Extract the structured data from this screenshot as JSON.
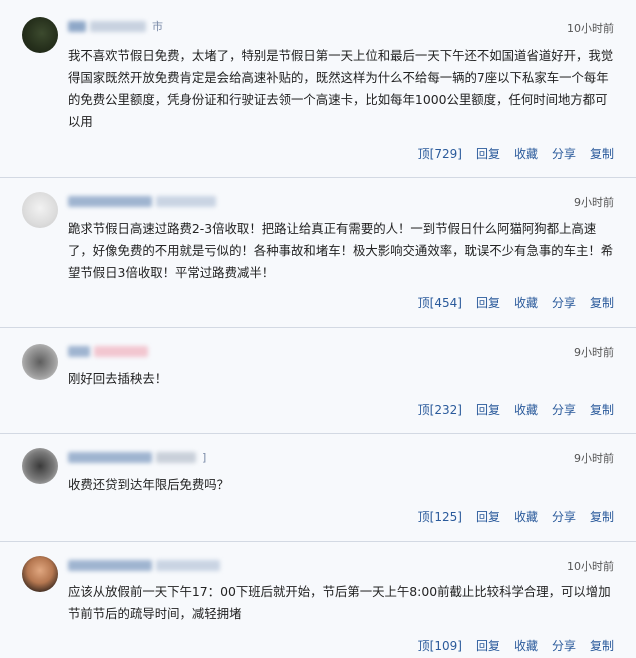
{
  "comments": [
    {
      "location_suffix": "市",
      "time": "10小时前",
      "text": "我不喜欢节假日免费，太堵了，特别是节假日第一天上位和最后一天下午还不如国道省道好开，我觉得国家既然开放免费肯定是会给高速补贴的，既然这样为什么不给每一辆的7座以下私家车一个每年的免费公里额度，凭身份证和行驶证去领一个高速卡，比如每年1000公里额度，任何时间地方都可以用",
      "actions": {
        "up_label": "顶",
        "up_count": "[729]",
        "reply": "回复",
        "favorite": "收藏",
        "share": "分享",
        "copy": "复制"
      }
    },
    {
      "location_suffix": "",
      "time": "9小时前",
      "text": "跪求节假日高速过路费2-3倍收取！把路让给真正有需要的人！一到节假日什么阿猫阿狗都上高速了，好像免费的不用就是亏似的！各种事故和堵车！极大影响交通效率，耽误不少有急事的车主！希望节假日3倍收取！平常过路费减半！",
      "actions": {
        "up_label": "顶",
        "up_count": "[454]",
        "reply": "回复",
        "favorite": "收藏",
        "share": "分享",
        "copy": "复制"
      }
    },
    {
      "location_suffix": "",
      "time": "9小时前",
      "text": "刚好回去插秧去！",
      "actions": {
        "up_label": "顶",
        "up_count": "[232]",
        "reply": "回复",
        "favorite": "收藏",
        "share": "分享",
        "copy": "复制"
      }
    },
    {
      "location_suffix": "]",
      "time": "9小时前",
      "text": "收费还贷到达年限后免费吗？",
      "actions": {
        "up_label": "顶",
        "up_count": "[125]",
        "reply": "回复",
        "favorite": "收藏",
        "share": "分享",
        "copy": "复制"
      }
    },
    {
      "location_suffix": "",
      "time": "10小时前",
      "text": "应该从放假前一天下午17：00下班后就开始，节后第一天上午8:00前截止比较科学合理，可以增加节前节后的疏导时间，减轻拥堵",
      "actions": {
        "up_label": "顶",
        "up_count": "[109]",
        "reply": "回复",
        "favorite": "收藏",
        "share": "分享",
        "copy": "复制"
      }
    }
  ]
}
